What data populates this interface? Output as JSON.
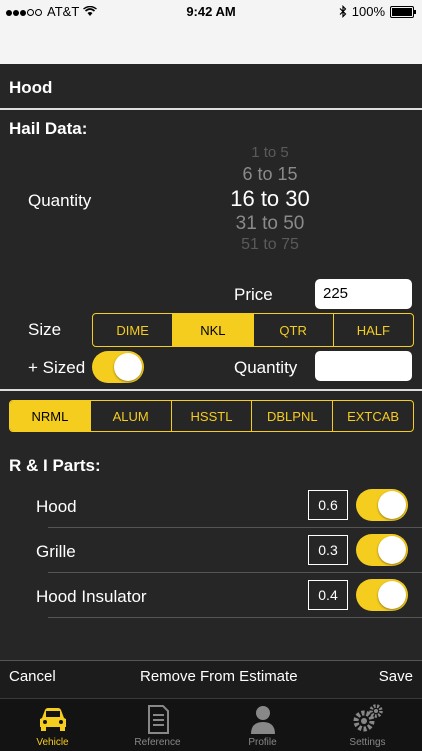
{
  "status": {
    "carrier": "AT&T",
    "time": "9:42 AM",
    "battery": "100%"
  },
  "panel": {
    "title": "Hood"
  },
  "hail": {
    "title": "Hail Data:",
    "quantity_label": "Quantity",
    "picker": [
      "1 to 5",
      "6 to 15",
      "16 to 30",
      "31 to 50",
      "51 to 75"
    ],
    "selected": "16 to 30",
    "price_label": "Price",
    "price_value": "225",
    "size_label": "Size",
    "sizes": [
      "DIME",
      "NKL",
      "QTR",
      "HALF"
    ],
    "size_selected": "NKL",
    "oversized_label": "+ Sized",
    "oversized_on": true,
    "quantity2_label": "Quantity",
    "quantity2_value": ""
  },
  "panel_types": {
    "items": [
      "NRML",
      "ALUM",
      "HSSTL",
      "DBLPNL",
      "EXTCAB"
    ],
    "selected": "NRML"
  },
  "ri": {
    "title": "R & I Parts:",
    "parts": [
      {
        "name": "Hood",
        "value": "0.6",
        "on": true
      },
      {
        "name": "Grille",
        "value": "0.3",
        "on": true
      },
      {
        "name": "Hood Insulator",
        "value": "0.4",
        "on": true
      }
    ]
  },
  "footer": {
    "cancel": "Cancel",
    "remove": "Remove From Estimate",
    "save": "Save"
  },
  "tabs": [
    {
      "label": "Vehicle",
      "icon": "car-icon",
      "active": true
    },
    {
      "label": "Reference",
      "icon": "document-icon",
      "active": false
    },
    {
      "label": "Profile",
      "icon": "person-icon",
      "active": false
    },
    {
      "label": "Settings",
      "icon": "gears-icon",
      "active": false
    }
  ],
  "colors": {
    "accent": "#f5cd1f",
    "background": "#262626"
  }
}
